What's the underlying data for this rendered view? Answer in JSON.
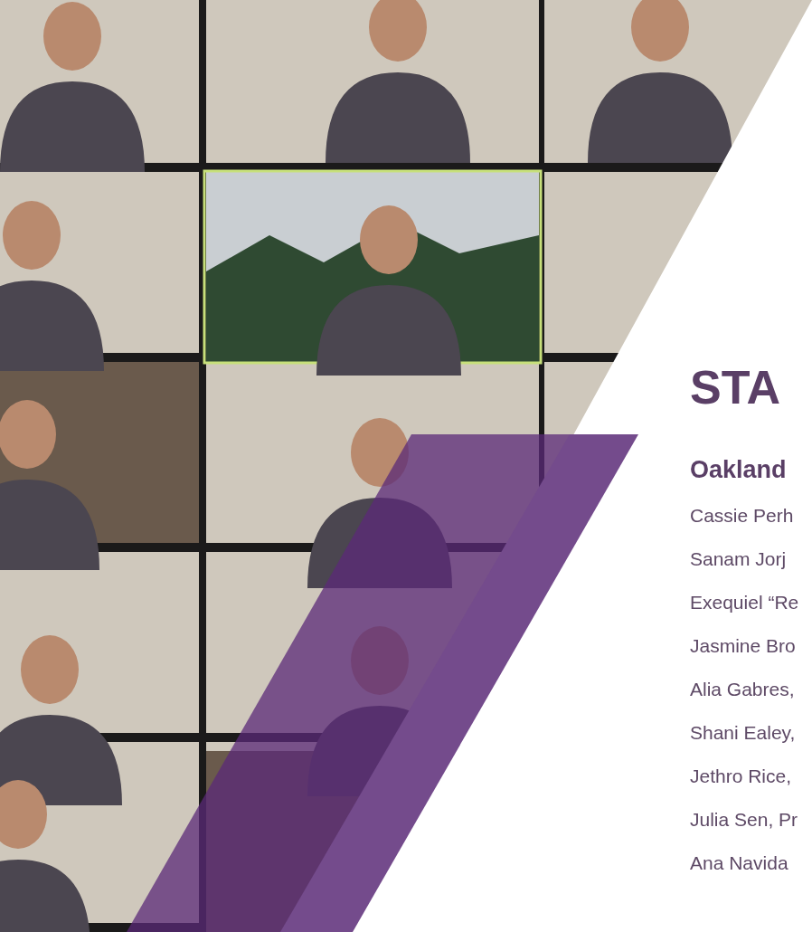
{
  "staff": {
    "heading": "STA",
    "office": "Oakland",
    "names": [
      "Cassie Perh",
      "Sanam Jorj",
      "Exequiel “Re",
      "Jasmine Bro",
      "Alia Gabres,",
      "Shani Ealey,",
      "Jethro Rice,",
      "Julia Sen, Pr",
      "Ana Navida"
    ]
  }
}
